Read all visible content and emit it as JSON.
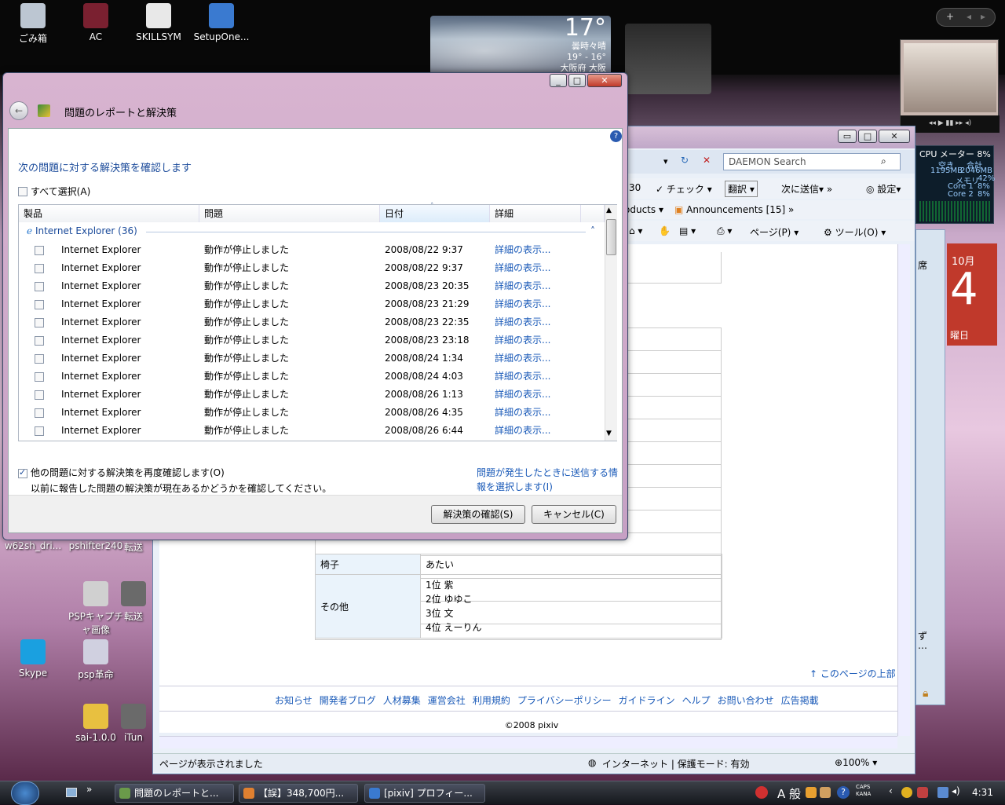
{
  "desktop": {
    "icons": [
      {
        "label": "ごみ箱",
        "color": "#bcc6d2"
      },
      {
        "label": "AC",
        "color": "#7a2030"
      },
      {
        "label": "SKILLSYM",
        "color": "#e8e8e8"
      },
      {
        "label": "SetupOne...",
        "color": "#3a7ad0"
      },
      {
        "label": "w62sh_dri...",
        "color": "#6a6a6a"
      },
      {
        "label": "pshifter240",
        "color": "#6a6a6a"
      },
      {
        "label": "転送",
        "color": "#6a6a6a"
      },
      {
        "label": "PSPキャプチャ画像",
        "color": "#d0d0d0"
      },
      {
        "label": "転送",
        "color": "#6a6a6a"
      },
      {
        "label": "Skype",
        "color": "#1aa0e0"
      },
      {
        "label": "psp革命",
        "color": "#d0d0e0"
      },
      {
        "label": "sai-1.0.0",
        "color": "#e8c040"
      },
      {
        "label": "iTun",
        "color": "#6a6a6a"
      }
    ]
  },
  "weather": {
    "temp": "17°",
    "condition": "曇時々晴",
    "range": "19° - 16°",
    "place": "大阪府 大阪"
  },
  "cpu_meter": {
    "title": "CPU メーター",
    "cpu": "8%",
    "mem_used": "1195MB",
    "mem_free": "2046MB",
    "mem_label": "メモリ",
    "mem_pct": "42%",
    "core1_label": "Core 1",
    "core1": "8%",
    "core2_label": "Core 2",
    "core2": "8%",
    "col_used": "空き",
    "col_total": "合計"
  },
  "calendar": {
    "month": "10月",
    "day": "4",
    "weekday": "曜日"
  },
  "ie": {
    "search_placeholder": "DAEMON Search",
    "toolbar": {
      "check": "チェック",
      "translate": "翻訳",
      "send": "次に送信▾",
      "settings": "設定▾",
      "products": "oducts",
      "announcements": "Announcements [15]",
      "page": "ページ(P)",
      "tools": "ツール(O)"
    },
    "profile_rows": [
      {
        "key": "椅子",
        "value": "あたい"
      },
      {
        "key": "その他",
        "value": "1位 紫\n2位 ゆゆこ\n3位 文\n4位 えーりん"
      }
    ],
    "back_to_top": "↑ このページの上部",
    "footer_links": [
      "お知らせ",
      "開発者ブログ",
      "人材募集",
      "運営会社",
      "利用規約",
      "プライバシーポリシー",
      "ガイドライン",
      "ヘルプ",
      "お問い合わせ",
      "広告掲載"
    ],
    "copyright": "©2008 pixiv",
    "status": "ページが表示されました",
    "zone": "インターネット | 保護モード: 有効",
    "zoom": "100%",
    "side_labels": {
      "seat": "席",
      "mid": "ず",
      "dots": "…"
    }
  },
  "dialog": {
    "title": "問題のレポートと解決策",
    "heading": "次の問題に対する解決策を確認します",
    "select_all": "すべて選択(A)",
    "columns": {
      "product": "製品",
      "problem": "問題",
      "date": "日付",
      "details": "詳細"
    },
    "group": "Internet Explorer (36)",
    "rows": [
      {
        "product": "Internet Explorer",
        "problem": "動作が停止しました",
        "date": "2008/08/22 9:37",
        "details": "詳細の表示..."
      },
      {
        "product": "Internet Explorer",
        "problem": "動作が停止しました",
        "date": "2008/08/22 9:37",
        "details": "詳細の表示..."
      },
      {
        "product": "Internet Explorer",
        "problem": "動作が停止しました",
        "date": "2008/08/23 20:35",
        "details": "詳細の表示..."
      },
      {
        "product": "Internet Explorer",
        "problem": "動作が停止しました",
        "date": "2008/08/23 21:29",
        "details": "詳細の表示..."
      },
      {
        "product": "Internet Explorer",
        "problem": "動作が停止しました",
        "date": "2008/08/23 22:35",
        "details": "詳細の表示..."
      },
      {
        "product": "Internet Explorer",
        "problem": "動作が停止しました",
        "date": "2008/08/23 23:18",
        "details": "詳細の表示..."
      },
      {
        "product": "Internet Explorer",
        "problem": "動作が停止しました",
        "date": "2008/08/24 1:34",
        "details": "詳細の表示..."
      },
      {
        "product": "Internet Explorer",
        "problem": "動作が停止しました",
        "date": "2008/08/24 4:03",
        "details": "詳細の表示..."
      },
      {
        "product": "Internet Explorer",
        "problem": "動作が停止しました",
        "date": "2008/08/26 1:13",
        "details": "詳細の表示..."
      },
      {
        "product": "Internet Explorer",
        "problem": "動作が停止しました",
        "date": "2008/08/26 4:35",
        "details": "詳細の表示..."
      },
      {
        "product": "Internet Explorer",
        "problem": "動作が停止しました",
        "date": "2008/08/26 6:44",
        "details": "詳細の表示..."
      }
    ],
    "recheck_label": "他の問題に対する解決策を再度確認します(O)",
    "recheck_desc": "以前に報告した問題の解決策が現在あるかどうかを確認してください。",
    "settings_link_1": "問題が発生したときに送信する情",
    "settings_link_2": "報を選択します(I)",
    "ok_button": "解決策の確認(S)",
    "cancel_button": "キャンセル(C)"
  },
  "taskbar": {
    "buttons": [
      {
        "label": "問題のレポートと...",
        "color": "#6a9a4a"
      },
      {
        "label": "【誤】348,700円...",
        "color": "#e08030"
      },
      {
        "label": "[pixiv] プロフィー...",
        "color": "#3a7ad0"
      }
    ],
    "ime": "A 般",
    "caps": "CAPS",
    "kana": "KANA",
    "time": "4:31"
  }
}
